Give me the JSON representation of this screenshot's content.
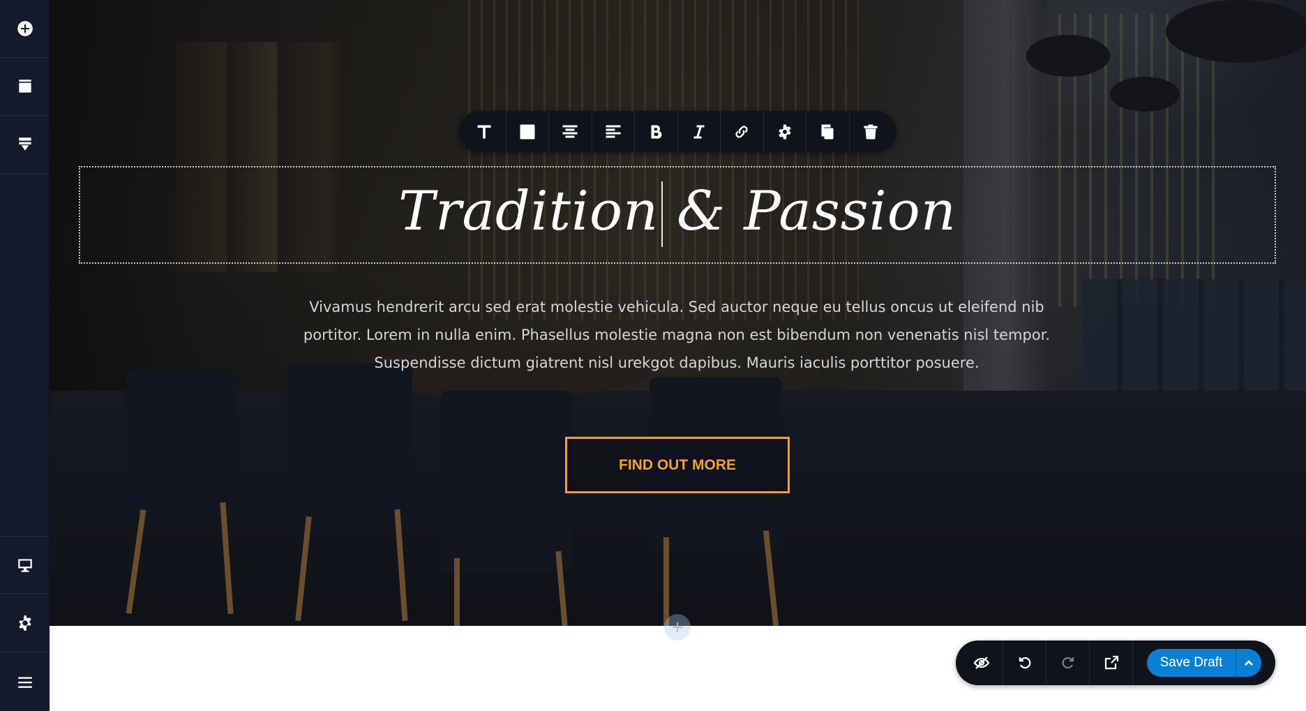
{
  "sidebar": {
    "top_items": [
      {
        "icon": "add-circle-icon"
      },
      {
        "icon": "blocks-icon"
      },
      {
        "icon": "download-icon"
      }
    ],
    "bottom_items": [
      {
        "icon": "monitor-icon"
      },
      {
        "icon": "gear-icon"
      },
      {
        "icon": "menu-icon"
      }
    ]
  },
  "toolbar": {
    "items": [
      {
        "icon": "text-icon"
      },
      {
        "icon": "color-square-icon"
      },
      {
        "icon": "align-center-icon"
      },
      {
        "icon": "align-left-icon"
      },
      {
        "icon": "bold-icon"
      },
      {
        "icon": "italic-icon"
      },
      {
        "icon": "link-icon"
      },
      {
        "icon": "gear-icon"
      },
      {
        "icon": "duplicate-icon"
      },
      {
        "icon": "trash-icon"
      }
    ]
  },
  "hero": {
    "heading": "Tradition & Passion",
    "body": "Vivamus hendrerit arcu sed erat molestie vehicula. Sed auctor neque eu tellus oncus ut eleifend nib portitor. Lorem in nulla enim. Phasellus molestie magna non est bibendum non venenatis nisl tempor. Suspendisse dictum giatrent nisl urekgot dapibus. Mauris iaculis porttitor posuere.",
    "cta_label": "FIND OUT MORE",
    "add_label": "+"
  },
  "actionbar": {
    "items": [
      {
        "icon": "hide-icon"
      },
      {
        "icon": "undo-icon"
      },
      {
        "icon": "redo-icon"
      },
      {
        "icon": "external-link-icon"
      }
    ],
    "save_label": "Save Draft"
  },
  "colors": {
    "sidebar_bg": "#141a2c",
    "toolbar_bg": "#0f131b",
    "cta_accent": "#f1a32a",
    "save_button": "#0a7fd4"
  }
}
